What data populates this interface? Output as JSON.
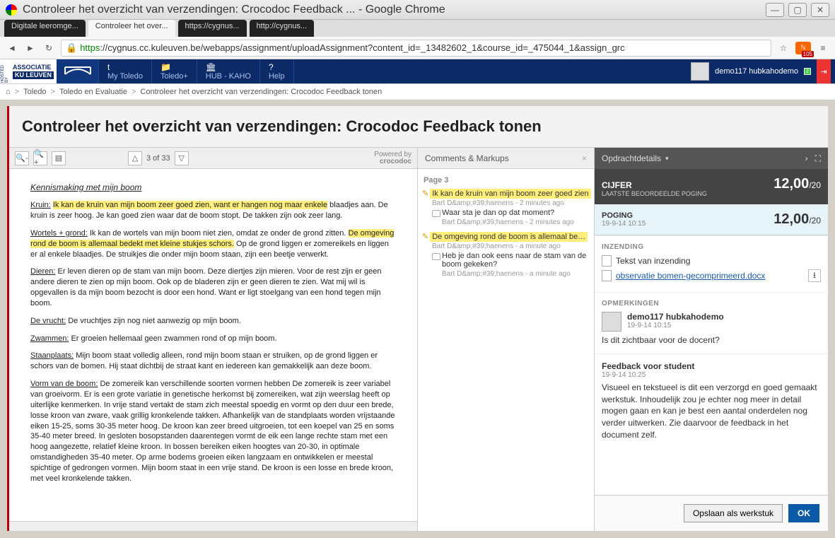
{
  "chrome": {
    "title": "Controleer het overzicht van verzendingen: Crocodoc Feedback ... - Google Chrome",
    "tabs": [
      "Digitale leeromge...",
      "Controleer het over...",
      "https://cygnus...",
      "http://cygnus..."
    ],
    "url_https": "https",
    "url_rest": "://cygnus.cc.kuleuven.be/webapps/assignment/uploadAssignment?content_id=_13482602_1&course_id=_475044_1&assign_grc",
    "rss_count": "105"
  },
  "nav": {
    "assoc_top": "ASSOCIATIE",
    "assoc_bottom": "KU LEUVEN",
    "hosted": "HOSTED BY",
    "items": [
      {
        "icon": "t",
        "label": "My Toledo"
      },
      {
        "icon": "📁",
        "label": "Toledo+"
      },
      {
        "icon": "🏛",
        "label": "HUB - KAHO"
      },
      {
        "icon": "?",
        "label": "Help"
      }
    ],
    "user": "demo117 hubkahodemo",
    "notif": "2"
  },
  "breadcrumbs": {
    "home": "⌂",
    "b1": "Toledo",
    "b2": "Toledo en Evaluatie",
    "b3": "Controleer het overzicht van verzendingen: Crocodoc Feedback tonen"
  },
  "page_title": "Controleer het overzicht van verzendingen: Crocodoc Feedback tonen",
  "doc_tb": {
    "pager": "3 of 33",
    "powered": "Powered by",
    "croc": "crocodoc"
  },
  "doc": {
    "title": "Kennismaking met mijn boom",
    "p1a": "Kruin:",
    "p1hl": "Ik kan de kruin van mijn boom zeer goed zien, want er hangen nog maar enkele",
    "p1b": "blaadjes aan. De kruin is zeer hoog. Je kan goed zien waar dat de boom stopt. De takken zijn ook zeer lang.",
    "p2a": "Wortels + grond:",
    "p2b": "Ik kan de wortels van mijn boom niet zien, omdat ze onder de grond zitten.",
    "p2hl": "De omgeving rond de boom is allemaal bedekt met kleine stukjes schors.",
    "p2c": "Op de grond liggen er zomereikels en liggen er al enkele blaadjes. De struikjes die onder mijn boom staan, zijn een beetje verwerkt.",
    "p3a": "Dieren:",
    "p3b": "Er leven dieren op de stam van mijn boom. Deze diertjes zijn mieren. Voor de rest zijn er geen andere dieren te zien op mijn boom. Ook op de bladeren zijn er geen dieren te zien. Wat mij wil is opgevallen is da mijn boom bezocht is door een hond. Want er ligt stoelgang van een hond tegen mijn boom.",
    "p4a": "De vrucht:",
    "p4b": "De vruchtjes zijn nog niet aanwezig op mijn boom.",
    "p5a": "Zwammen:",
    "p5b": "Er groeien hellemaal geen zwammen rond of op mijn boom.",
    "p6a": "Staanplaats:",
    "p6b": "Mijn boom staat volledig alleen, rond mijn boom staan er struiken, op de grond liggen er schors van de bomen. Hij staat dichtbij de straat kant en iedereen kan gemakkelijk aan deze boom.",
    "p7a": "Vorm van de boom:",
    "p7b": "De zomereik kan verschillende soorten vormen hebben De zomereik is zeer variabel van groeivorm. Er is een grote variatie in genetische herkomst bij zomereiken, wat zijn weerslag heeft op uiterlijke kenmerken. In vrije stand vertakt de stam zich meestal spoedig en vormt op den duur een brede, losse kroon van zware, vaak grillig kronkelende takken. Afhankelijk van de standplaats worden vrijstaande eiken 15-25, soms 30-35 meter hoog. De kroon kan zeer breed uitgroeien, tot een koepel van 25 en soms 35-40 meter breed. In gesloten bosopstanden daarentegen vormt de eik een lange rechte stam met een hoog aangezette, relatief kleine kroon. In bossen bereiken eiken hoogtes van 20-30, in optimale omstandigheden 35-40 meter. Op arme bodems groeien eiken langzaam en ontwikkelen er meestal spichtige of gedrongen vormen. Mijn boom staat in een vrije stand. De kroon is een losse en brede kroon, met veel kronkelende takken."
  },
  "comments": {
    "header": "Comments & Markups",
    "page": "Page 3",
    "items": [
      {
        "hl": "Ik kan de kruin van mijn boom zeer goed zien",
        "author": "Bart D&amp;#39;haenens",
        "time": "2 minutes ago",
        "reply": "Waar sta je dan op dat moment?",
        "reply_author": "Bart D&amp;#39;haenens",
        "reply_time": "2 minutes ago"
      },
      {
        "hl": "De omgeving rond de boom is allemaal be…",
        "author": "Bart D&amp;#39;haenens",
        "time": "a minute ago",
        "reply": "Heb je dan ook eens naar de stam van de boom gekeken?",
        "reply_author": "Bart D&amp;#39;haenens",
        "reply_time": "a minute ago"
      }
    ]
  },
  "details": {
    "head": "Opdrachtdetails",
    "grade_lbl": "CIJFER",
    "grade_sub": "LAATSTE BEOORDEELDE POGING",
    "grade_val": "12,00",
    "grade_max": "/20",
    "attempt_lbl": "POGING",
    "attempt_ts": "19-9-14 10:15",
    "attempt_val": "12,00",
    "attempt_max": "/20",
    "inzending_h": "INZENDING",
    "tekst": "Tekst van inzending",
    "file": "observatie bomen-gecomprimeerd.docx",
    "opm_h": "OPMERKINGEN",
    "opm_user": "demo117 hubkahodemo",
    "opm_ts": "19-9-14 10:15",
    "opm_text": "Is dit zichtbaar voor de docent?",
    "fb_h": "Feedback voor student",
    "fb_ts": "19-9-14 10:25",
    "fb_text": "Visueel en tekstueel is dit een verzorgd en goed gemaakt werkstuk. Inhoudelijk zou je echter nog meer in detail mogen gaan en kan je best een aantal onderdelen nog verder uitwerken. Zie daarvoor de feedback in het document zelf.",
    "btn_save": "Opslaan als werkstuk",
    "btn_ok": "OK"
  }
}
